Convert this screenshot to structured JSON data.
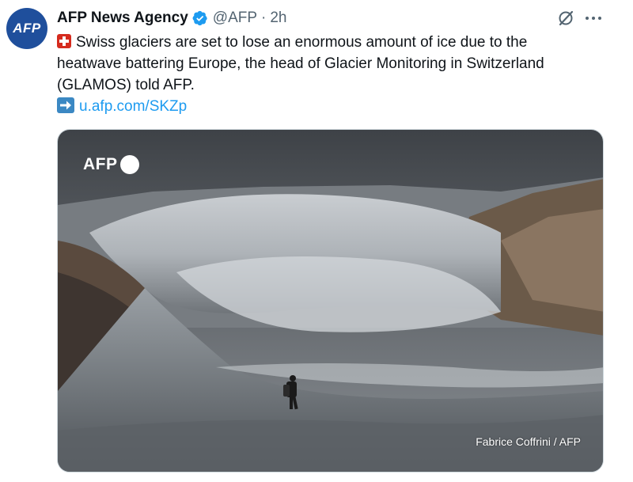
{
  "tweet": {
    "author": {
      "avatar_text": "AFP",
      "display_name": "AFP News Agency",
      "handle": "@AFP",
      "separator": "·",
      "timestamp": "2h",
      "verified": true
    },
    "text": {
      "line1": "Swiss glaciers are set to lose an enormous amount of ice due to the",
      "line2": "heatwave battering Europe, the head of Glacier Monitoring in Switzerland",
      "line3": "(GLAMOS) told AFP.",
      "link": "u.afp.com/SKZp",
      "emoji_1": "swiss-flag-emoji",
      "emoji_2": "right-arrow-emoji"
    },
    "media": {
      "watermark": "AFP",
      "credit": "Fabrice Coffrini / AFP",
      "image_subject": "hiker on glacier"
    }
  },
  "colors": {
    "text": "#0f1419",
    "secondary": "#536471",
    "link": "#1d9bf0",
    "verified": "#1d9bf0",
    "avatar_bg": "#1f4f9c"
  },
  "icons": [
    "verified-badge-icon",
    "grok-icon",
    "more-options-icon"
  ]
}
